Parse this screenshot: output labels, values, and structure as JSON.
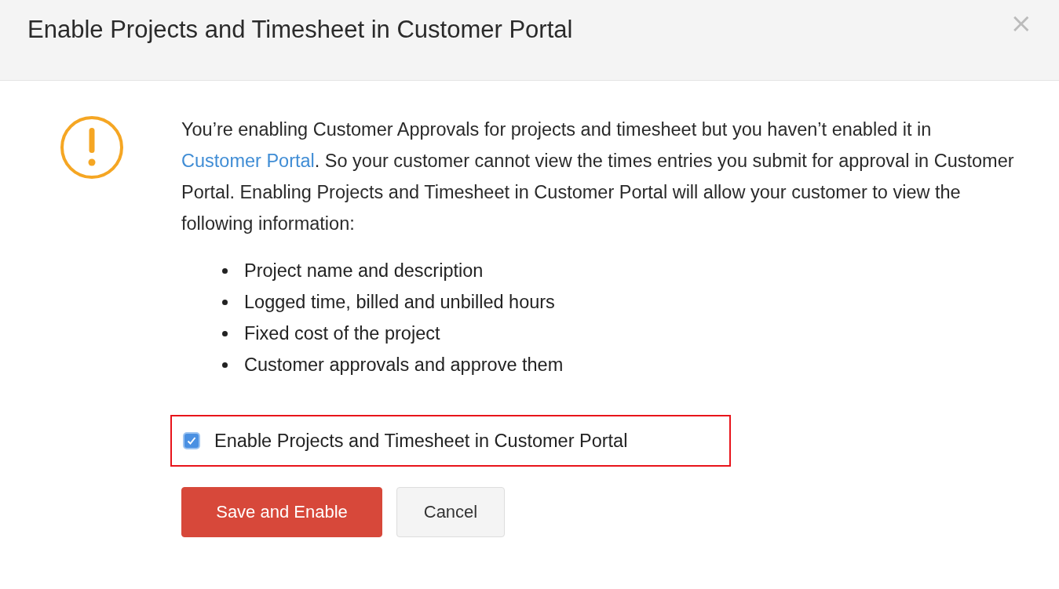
{
  "dialog": {
    "title": "Enable Projects and Timesheet in Customer Portal",
    "close": "×"
  },
  "message": {
    "before": "You’re enabling Customer Approvals for projects and timesheet but you haven’t enabled it in ",
    "link": "Customer Portal",
    "after": ". So your customer cannot view the times entries you submit for approval in Customer Portal. Enabling Projects and Timesheet in Customer Portal will allow your customer to view the following information:"
  },
  "items": [
    "Project name and description",
    "Logged time, billed and unbilled hours",
    "Fixed cost of the project",
    "Customer approvals and approve them"
  ],
  "option": {
    "label": "Enable Projects and Timesheet in Customer Portal",
    "checked": true,
    "highlighted": true
  },
  "buttons": [
    {
      "label": "Save and Enable",
      "kind": "primary"
    },
    {
      "label": "Cancel",
      "kind": "secondary"
    }
  ]
}
